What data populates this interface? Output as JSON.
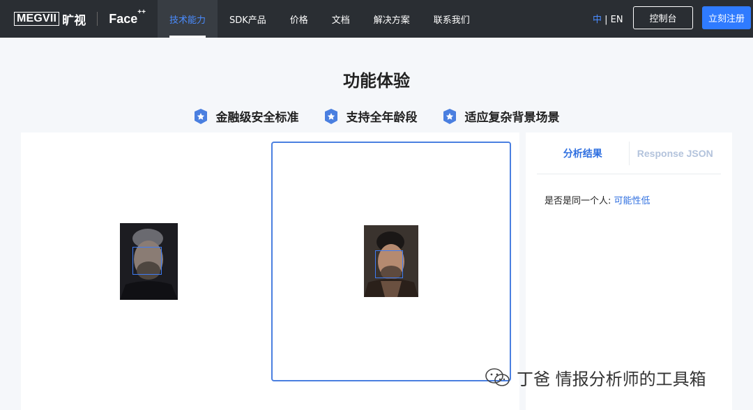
{
  "nav": {
    "brand_megvii": "MEGVII",
    "brand_cn": "旷视",
    "brand_face": "Face",
    "brand_face_sup": "++",
    "menu": [
      {
        "label": "技术能力",
        "active": true
      },
      {
        "label": "SDK产品",
        "active": false
      },
      {
        "label": "价格",
        "active": false
      },
      {
        "label": "文档",
        "active": false
      },
      {
        "label": "解决方案",
        "active": false
      },
      {
        "label": "联系我们",
        "active": false
      }
    ],
    "lang_cn": "中",
    "lang_sep": " | ",
    "lang_en": "EN",
    "console_label": "控制台",
    "register_label": "立刻注册"
  },
  "page": {
    "title": "功能体验",
    "features": [
      "金融级安全标准",
      "支持全年龄段",
      "适应复杂背景场景"
    ]
  },
  "results": {
    "tabs": [
      {
        "label": "分析结果",
        "active": true
      },
      {
        "label": "Response JSON",
        "active": false
      }
    ],
    "question": "是否是同一个人: ",
    "answer": "可能性低"
  },
  "watermark": {
    "text": "丁爸 情报分析师的工具箱"
  },
  "colors": {
    "nav_bg": "#2a2e33",
    "accent": "#2f7bff",
    "active_tab": "#4a8cff",
    "page_bg": "#f5f7fa"
  }
}
